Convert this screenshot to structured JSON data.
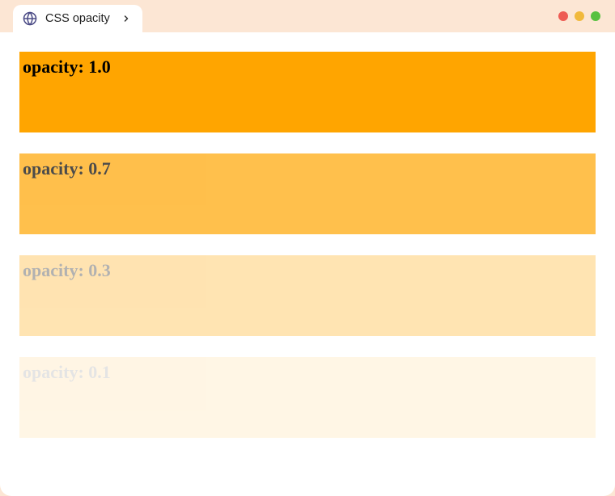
{
  "tab": {
    "title": "CSS opacity"
  },
  "colors": {
    "box_background": "orange"
  },
  "boxes": [
    {
      "label": "opacity: 1.0",
      "opacity": 1.0
    },
    {
      "label": "opacity: 0.7",
      "opacity": 0.7
    },
    {
      "label": "opacity: 0.3",
      "opacity": 0.3
    },
    {
      "label": "opacity: 0.1",
      "opacity": 0.1
    }
  ]
}
